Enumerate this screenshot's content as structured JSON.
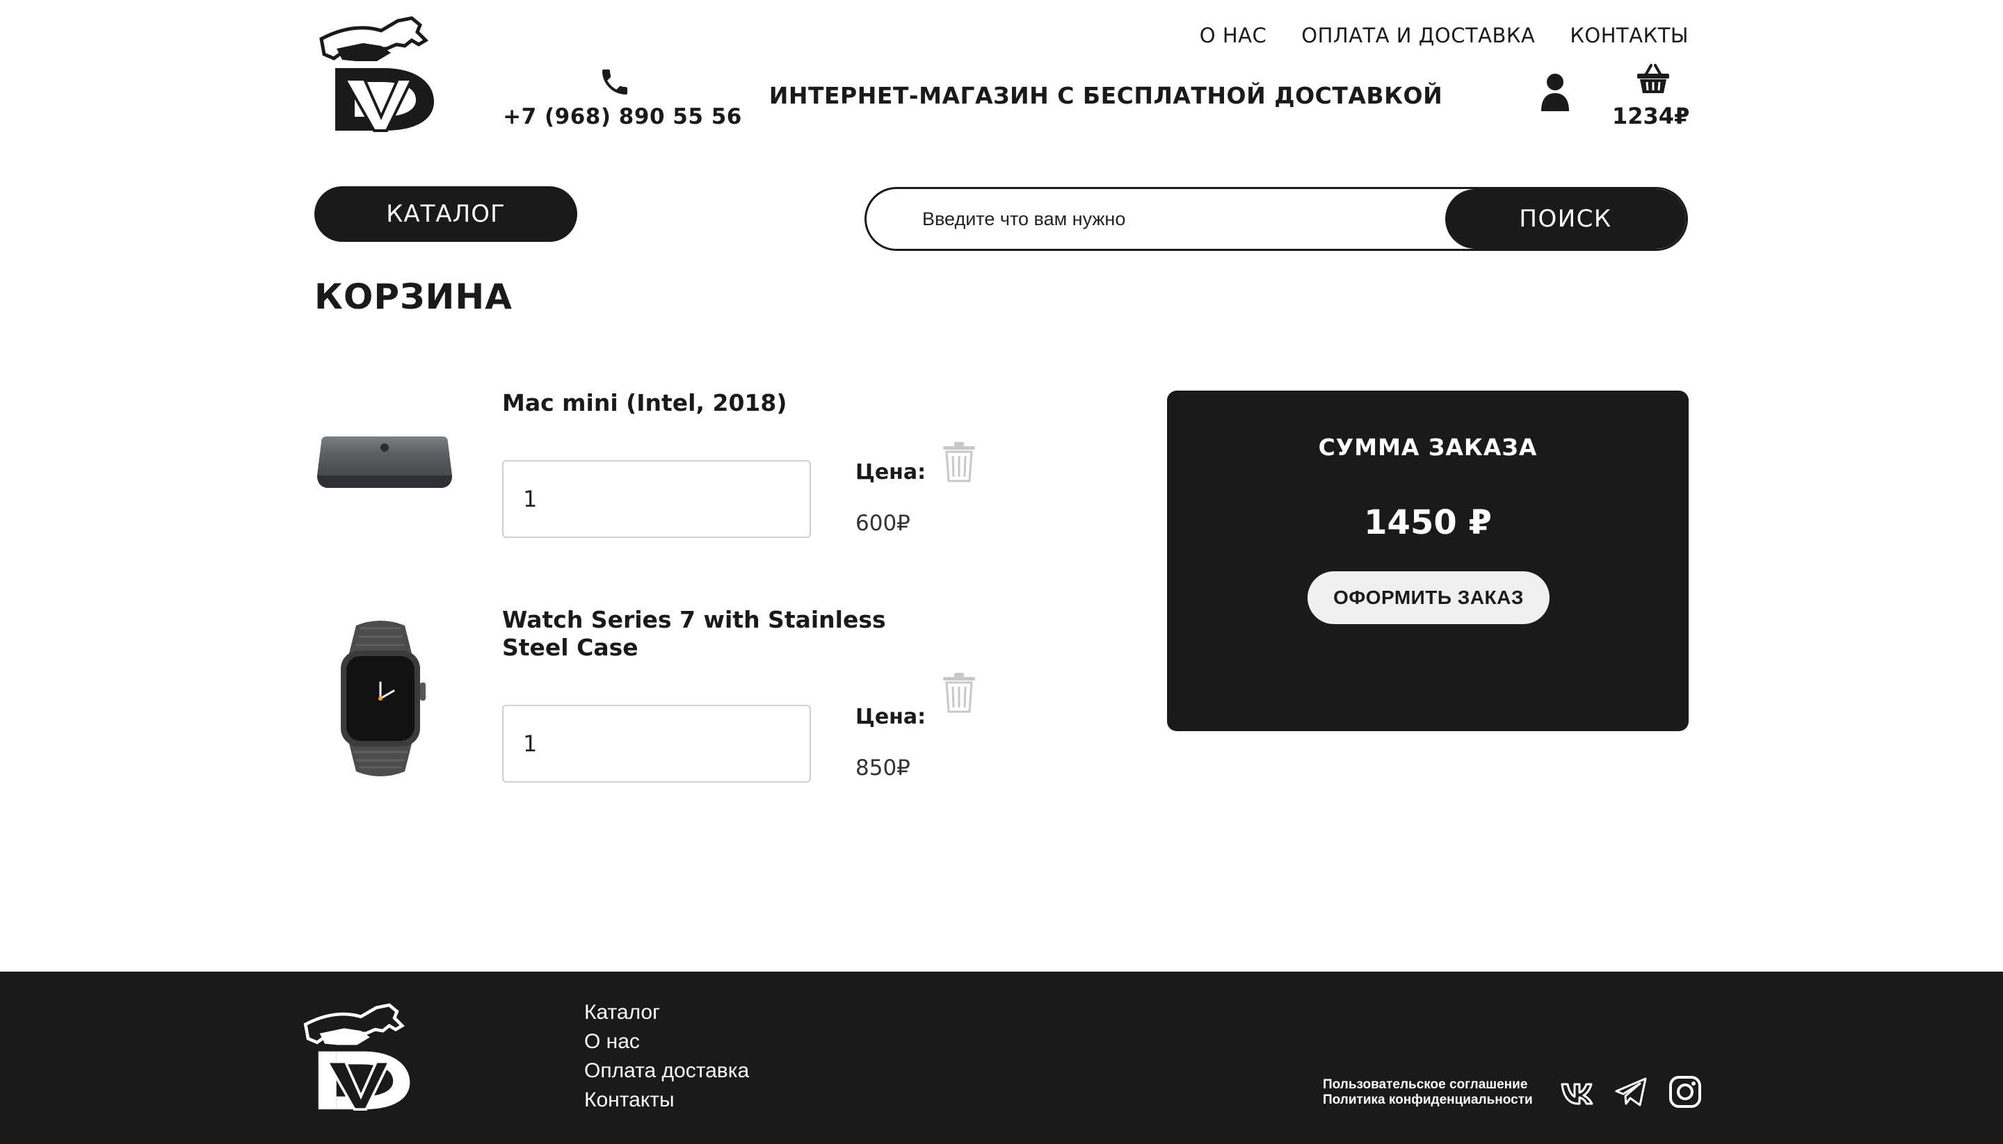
{
  "header": {
    "phone": "+7 (968) 890 55 56",
    "tagline": "ИНТЕРНЕТ-МАГАЗИН С БЕСПЛАТНОЙ ДОСТАВКОЙ",
    "nav": [
      "О НАС",
      "ОПЛАТА И ДОСТАВКА",
      "КОНТАКТЫ"
    ],
    "cart_total": "1234₽"
  },
  "toolbar": {
    "catalog_label": "КАТАЛОГ",
    "search_placeholder": "Введите что вам нужно",
    "search_button": "ПОИСК"
  },
  "page_title": "КОРЗИНА",
  "cart": {
    "items": [
      {
        "name": "Mac mini (Intel, 2018)",
        "quantity": "1",
        "price_label": "Цена:",
        "price": "600₽",
        "image": "mac-mini"
      },
      {
        "name": "Watch Series 7 with Stainless Steel Case",
        "quantity": "1",
        "price_label": "Цена:",
        "price": "850₽",
        "image": "apple-watch"
      }
    ]
  },
  "summary": {
    "title": "СУММА ЗАКАЗА",
    "total": "1450 ₽",
    "order_button": "ОФОРМИТЬ ЗАКАЗ"
  },
  "footer": {
    "nav": [
      "Каталог",
      "О нас",
      "Оплата доставка",
      "Контакты"
    ],
    "legal": [
      "Пользовательское соглашение",
      "Политика конфиденциальности"
    ],
    "social": [
      "vk-icon",
      "telegram-icon",
      "instagram-icon"
    ]
  },
  "colors": {
    "dark": "#1a1a1a",
    "white": "#ffffff",
    "light_btn": "#f0f0f0",
    "trash": "#c8c8c8"
  }
}
